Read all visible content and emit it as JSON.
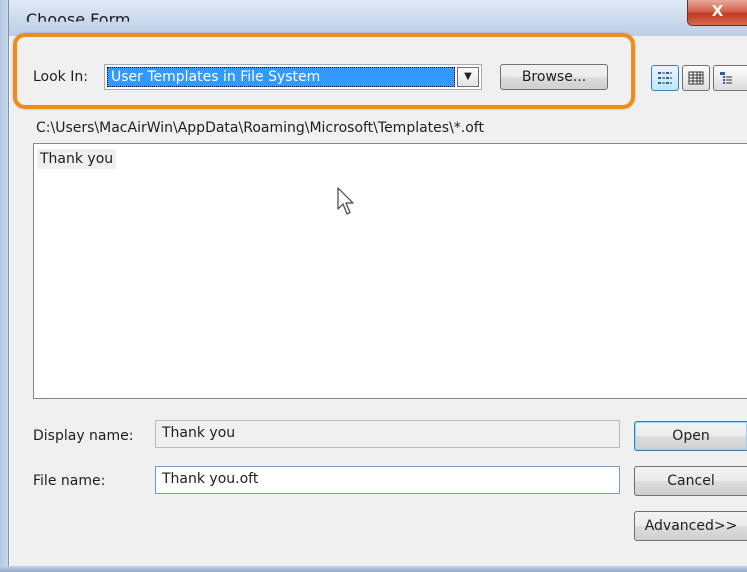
{
  "window": {
    "title": "Choose Form",
    "close_glyph": "X"
  },
  "look_in": {
    "label": "Look In:",
    "selected": "User Templates in File System",
    "browse_label": "Browse..."
  },
  "view_buttons": [
    {
      "icon": "small-icons-view-icon",
      "selected": true
    },
    {
      "icon": "list-view-icon",
      "selected": false
    },
    {
      "icon": "details-view-icon",
      "selected": false
    }
  ],
  "path": "C:\\Users\\MacAirWin\\AppData\\Roaming\\Microsoft\\Templates\\*.oft",
  "list": {
    "items": [
      "Thank you"
    ]
  },
  "display_name": {
    "label": "Display name:",
    "value": "Thank you"
  },
  "file_name": {
    "label": "File name:",
    "value": "Thank you.oft"
  },
  "buttons": {
    "open": "Open",
    "cancel": "Cancel",
    "advanced": "Advanced>>"
  },
  "colors": {
    "highlight": "#f28a1a",
    "selection": "#3399ff"
  }
}
